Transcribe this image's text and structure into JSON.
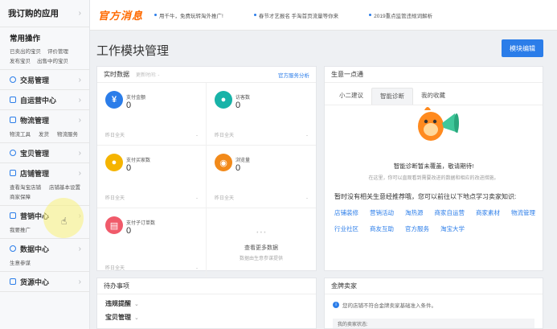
{
  "sidebar": {
    "header": "我订购的应用",
    "common": {
      "title": "常用操作",
      "links": [
        "已卖出的宝贝",
        "评价管理",
        "发布宝贝",
        "出售中的宝贝"
      ]
    },
    "sections": [
      {
        "label": "交易管理",
        "icon": "trade-icon",
        "sub": []
      },
      {
        "label": "自运营中心",
        "icon": "chat-icon",
        "sub": []
      },
      {
        "label": "物流管理",
        "icon": "logistics-icon",
        "sub": [
          "物流工具",
          "发货",
          "物流服务"
        ]
      },
      {
        "label": "宝贝管理",
        "icon": "goods-icon",
        "sub": []
      },
      {
        "label": "店铺管理",
        "icon": "shop-icon",
        "sub": [
          "查看淘宝店铺",
          "店铺基本设置",
          "商家保障"
        ]
      },
      {
        "label": "营销中心",
        "icon": "marketing-icon",
        "sub": [
          "我要推广"
        ]
      },
      {
        "label": "数据中心",
        "icon": "data-icon",
        "sub": [
          "生意参谋"
        ]
      },
      {
        "label": "货源中心",
        "icon": "supply-icon",
        "sub": []
      }
    ]
  },
  "banner": {
    "logo": "官方消息",
    "messages": [
      "用千牛，免费玩转淘外推广!",
      "春节才艺报名 手淘首页流量等你来",
      "2019重点监管违规词解析"
    ]
  },
  "page": {
    "title": "工作模块管理",
    "edit_button": "模块编辑"
  },
  "realtime": {
    "title": "实时数据",
    "updated": "更新时间: -",
    "link": "官方服务分析",
    "cells": [
      {
        "icon": "yuan-icon",
        "symbol": "¥",
        "color": "#2b7de9",
        "label": "支付金额",
        "value": "0",
        "foot": "昨日全天",
        "dash": "-"
      },
      {
        "icon": "visitor-icon",
        "symbol": "●",
        "color": "#18b3a8",
        "label": "访客数",
        "value": "0",
        "foot": "昨日全天",
        "dash": "-"
      },
      {
        "icon": "buyer-icon",
        "symbol": "●",
        "color": "#f5b400",
        "label": "支付买家数",
        "value": "0",
        "foot": "昨日全天",
        "dash": "-"
      },
      {
        "icon": "pageview-icon",
        "symbol": "◉",
        "color": "#f28a1a",
        "label": "浏览量",
        "value": "0",
        "foot": "昨日全天",
        "dash": "-"
      },
      {
        "icon": "orders-icon",
        "symbol": "▤",
        "color": "#f05a6a",
        "label": "支付子订单数",
        "value": "0",
        "foot": "昨日全天",
        "dash": "-"
      }
    ],
    "more_title": "查看更多数据",
    "more_sub": "数据由生意参谋提供"
  },
  "biz": {
    "title": "生意一点通",
    "tabs": [
      "小二建议",
      "智能诊断",
      "我的收藏"
    ],
    "active_tab": 1,
    "line1": "智能诊断暂未覆盖，敬请期待!",
    "line2": "在这里，你可以直观看到需要改进的数据和相应的改进措施。",
    "line3": "暂时没有相关生意经推荐哦，您可以前往以下地点学习卖家知识:",
    "links": [
      "店铺装修",
      "营销活动",
      "淘热源",
      "商家自运营",
      "商家素材",
      "物流管理",
      "行业社区",
      "商友互助",
      "官方服务",
      "淘宝大学"
    ]
  },
  "todo": {
    "title": "待办事项",
    "items": [
      "违规提醒",
      "宝贝管理"
    ]
  },
  "gold": {
    "title": "金牌卖家",
    "info": "您的店铺不符合金牌卖家基础准入条件。",
    "bar": "我的卖家状态:"
  }
}
